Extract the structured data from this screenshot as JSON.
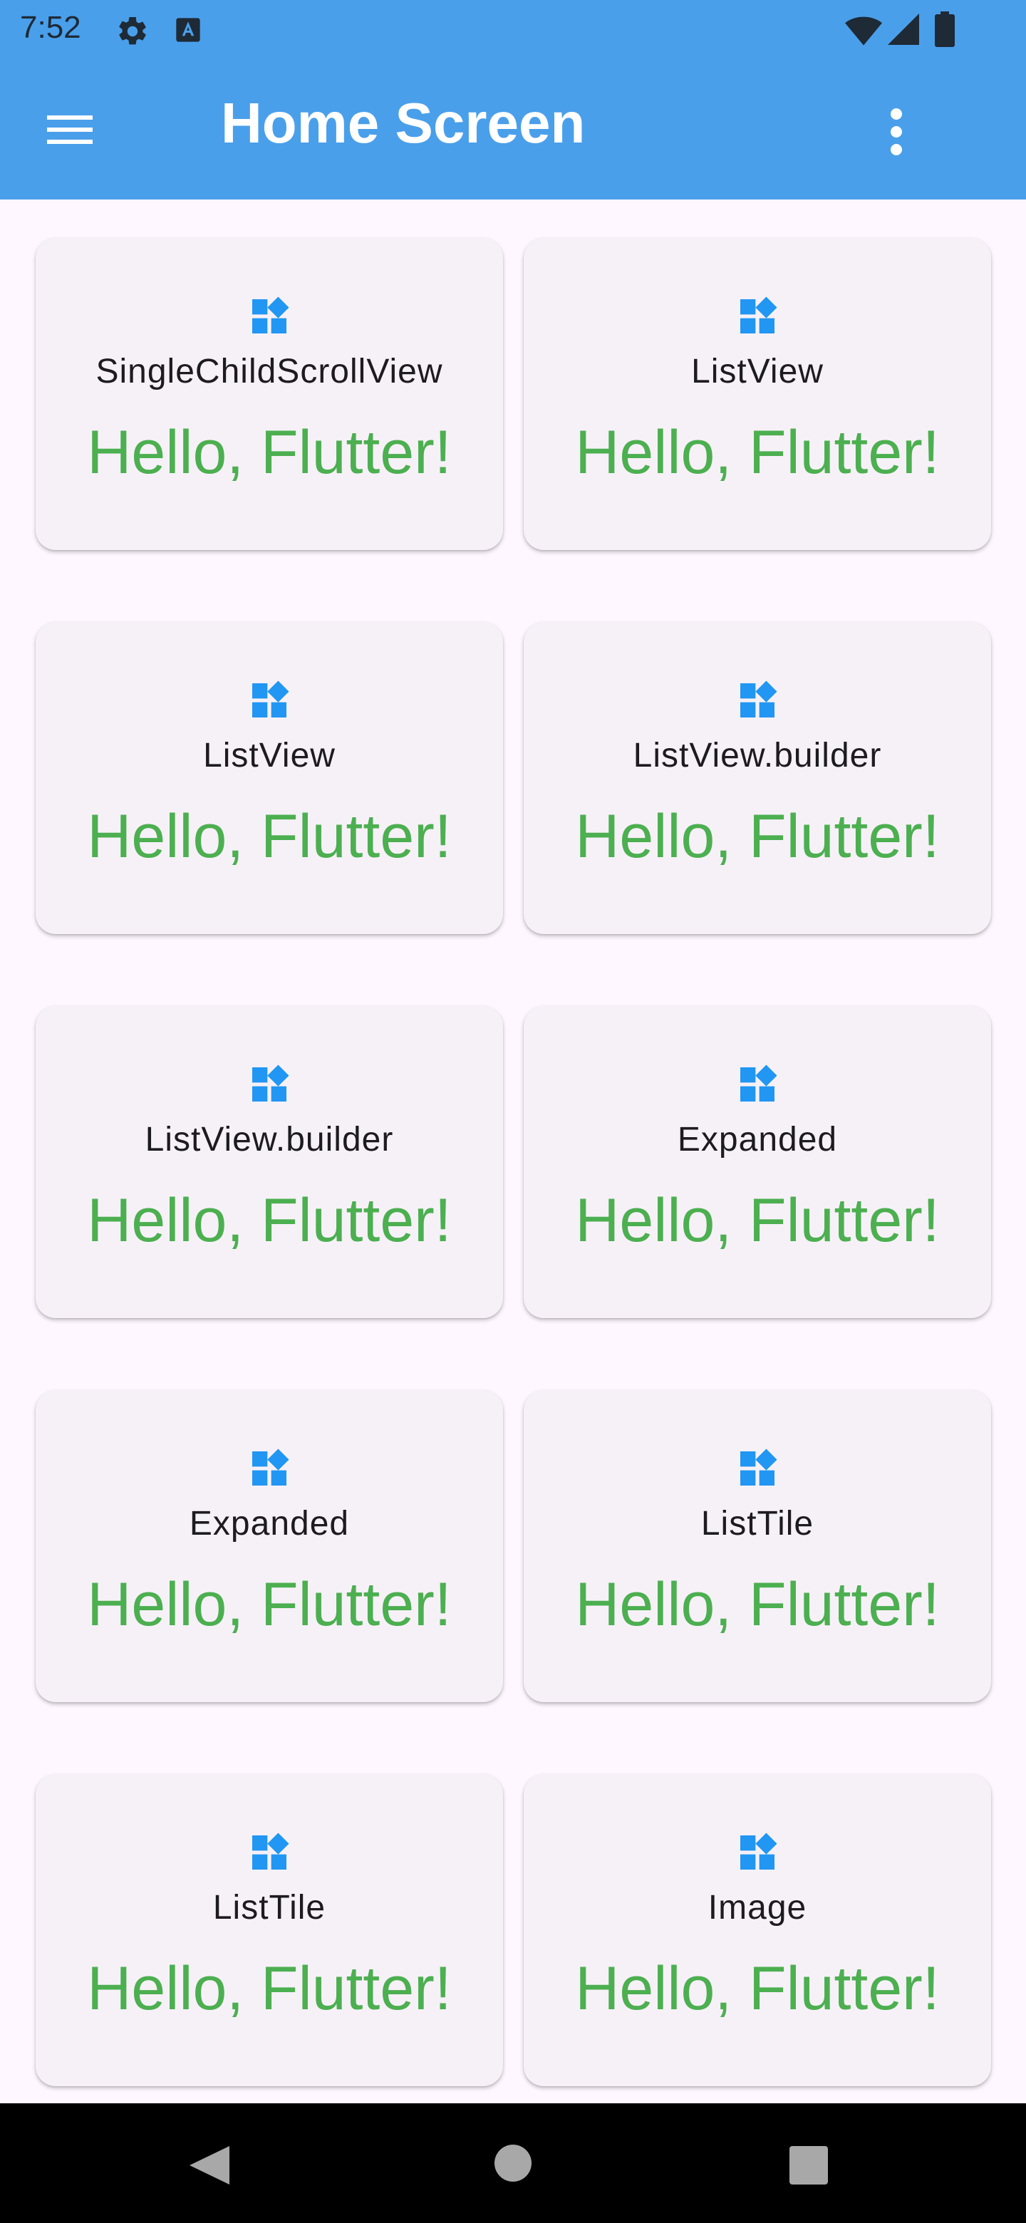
{
  "status_bar": {
    "time": "7:52",
    "icons_left": [
      "settings-icon",
      "accessibility-a-icon"
    ],
    "icons_right": [
      "wifi-icon",
      "signal-icon",
      "battery-icon"
    ]
  },
  "app_bar": {
    "title": "Home Screen",
    "menu_icon": "hamburger-menu-icon",
    "more_icon": "more-vert-icon",
    "background": "#4a9fea"
  },
  "cards": [
    {
      "title": "SingleChildScrollView",
      "greeting": "Hello, Flutter!"
    },
    {
      "title": "ListView",
      "greeting": "Hello, Flutter!"
    },
    {
      "title": "ListView",
      "greeting": "Hello, Flutter!"
    },
    {
      "title": "ListView.builder",
      "greeting": "Hello, Flutter!"
    },
    {
      "title": "ListView.builder",
      "greeting": "Hello, Flutter!"
    },
    {
      "title": "Expanded",
      "greeting": "Hello, Flutter!"
    },
    {
      "title": "Expanded",
      "greeting": "Hello, Flutter!"
    },
    {
      "title": "ListTile",
      "greeting": "Hello, Flutter!"
    },
    {
      "title": "ListTile",
      "greeting": "Hello, Flutter!"
    },
    {
      "title": "Image",
      "greeting": "Hello, Flutter!"
    }
  ],
  "card_icon": "widgets-icon",
  "colors": {
    "accent": "#2196f3",
    "greeting": "#4caf50",
    "card_bg": "#f6f1f7",
    "page_bg": "#fef7ff"
  },
  "nav_bar": {
    "icons": [
      "back-icon",
      "home-icon",
      "recents-icon"
    ]
  }
}
